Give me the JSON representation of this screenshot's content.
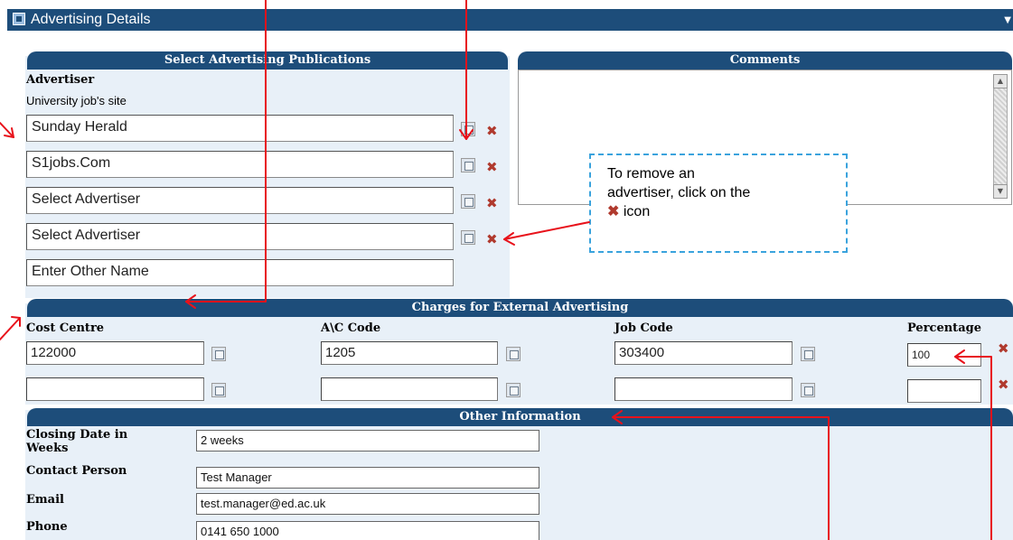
{
  "window": {
    "title": "Advertising Details"
  },
  "publications": {
    "header": "Select Advertising Publications",
    "advertiser_label": "Advertiser",
    "site_label": "University job's site",
    "rows": [
      "Sunday Herald",
      "S1jobs.Com",
      "Select Advertiser",
      "Select Advertiser"
    ],
    "other_name": "Enter Other Name"
  },
  "comments": {
    "header": "Comments",
    "value": ""
  },
  "callout": {
    "line1": "To remove an",
    "line2": "advertiser, click on the",
    "line3": "icon"
  },
  "charges": {
    "header": "Charges for External Advertising",
    "columns": [
      "Cost Centre",
      "A\\C Code",
      "Job Code",
      "Percentage"
    ],
    "rows": [
      {
        "cost_centre": "122000",
        "ac_code": "1205",
        "job_code": "303400",
        "percentage": "100"
      },
      {
        "cost_centre": "",
        "ac_code": "",
        "job_code": "",
        "percentage": ""
      }
    ]
  },
  "other": {
    "header": "Other Information",
    "closing_label_1": "Closing Date in",
    "closing_label_2": "Weeks",
    "closing_value": "2 weeks",
    "contact_label": "Contact Person",
    "contact_value": "Test Manager",
    "email_label": "Email",
    "email_value": "test.manager@ed.ac.uk",
    "phone_label": "Phone",
    "phone_value": "0141 650 1000"
  },
  "icons": {
    "lookup": "lookup-icon",
    "remove": "remove-x-icon",
    "window": "window-icon"
  },
  "colors": {
    "header": "#1d4d7a",
    "panel": "#e8f0f8",
    "annotation": "#e8121b",
    "callout_border": "#3aa3dd",
    "remove_icon": "#b03a2e"
  }
}
